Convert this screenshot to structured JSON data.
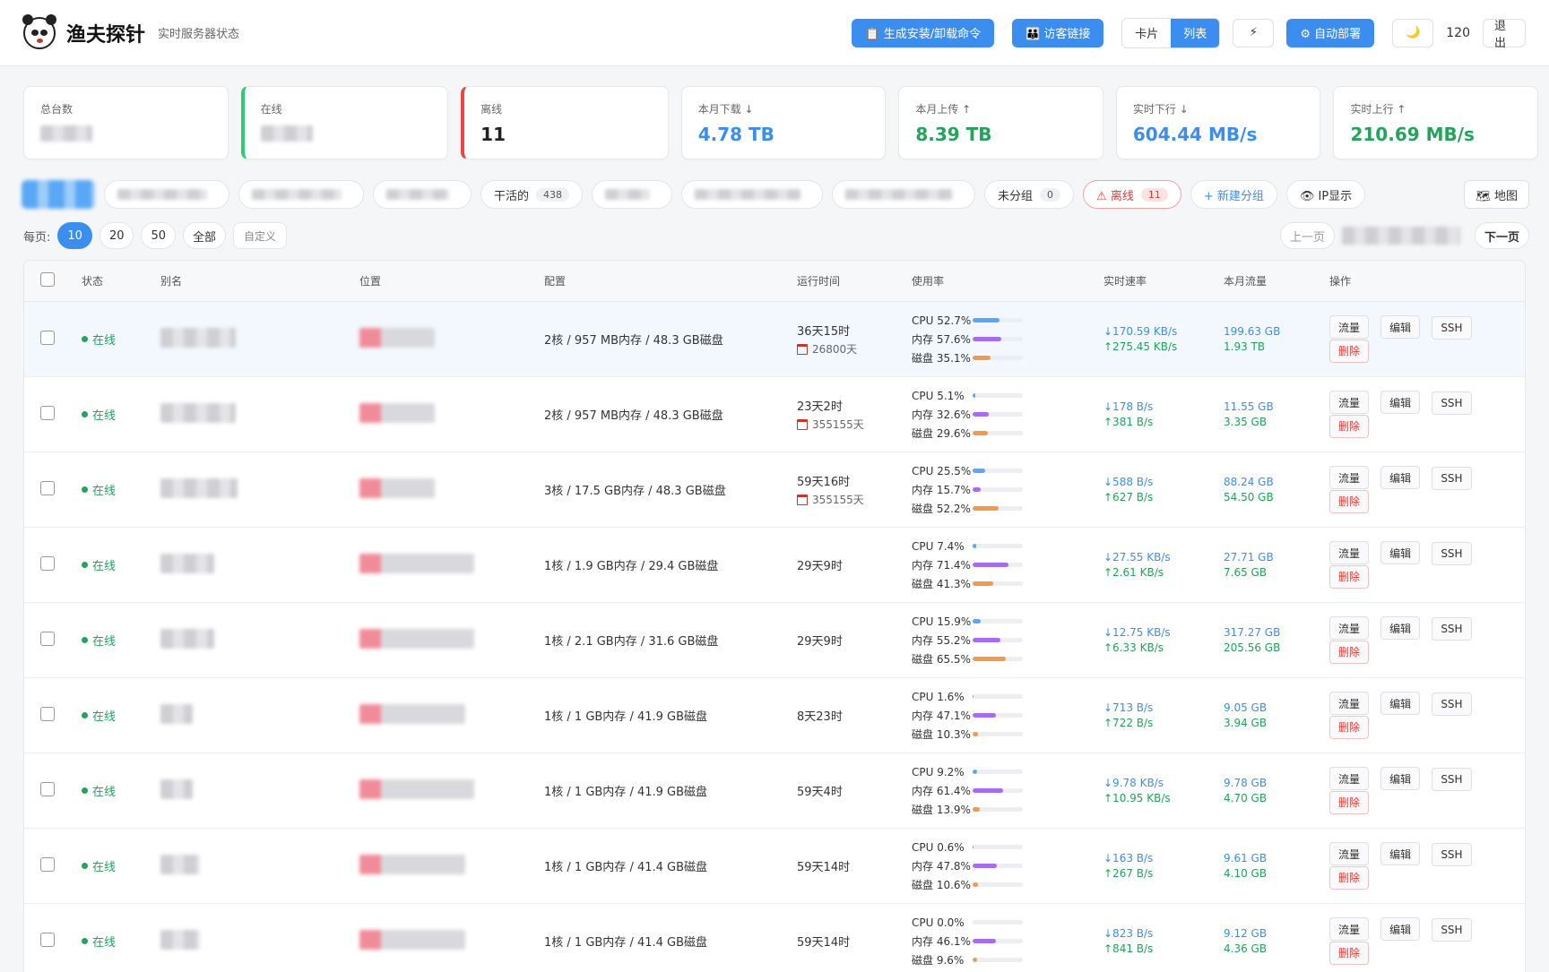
{
  "header": {
    "brand": "渔夫探针",
    "subtitle": "实时服务器状态",
    "gen_btn": "📋 生成安装/卸载命令",
    "visitor_btn": "👪 访客链接",
    "view_card": "卡片",
    "view_list": "列表",
    "flash_icon": "⚡",
    "deploy_btn": "⚙ 自动部署",
    "theme_icon": "🌙",
    "refresh": "120",
    "logout": "退出"
  },
  "stats": [
    {
      "label": "总台数",
      "value": ""
    },
    {
      "label": "在线",
      "value": ""
    },
    {
      "label": "离线",
      "value": "11"
    },
    {
      "label": "本月下载 ↓",
      "value": "4.78 TB"
    },
    {
      "label": "本月上传 ↑",
      "value": "8.39 TB"
    },
    {
      "label": "实时下行 ↓",
      "value": "604.44 MB/s"
    },
    {
      "label": "实时上行 ↑",
      "value": "210.69 MB/s"
    }
  ],
  "groups": {
    "ganhuo": {
      "label": "干活的",
      "count": "438"
    },
    "ungrouped": {
      "label": "未分组",
      "count": "0"
    },
    "offline": {
      "label": "⚠ 离线",
      "count": "11"
    },
    "new_group": "+ 新建分组",
    "ip_show": "👁 IP显示",
    "map": "🗺 地图"
  },
  "pager": {
    "label": "每页:",
    "options": [
      "10",
      "20",
      "50",
      "全部"
    ],
    "custom": "自定义",
    "prev": "上一页",
    "next": "下一页"
  },
  "table": {
    "headers": [
      "状态",
      "别名",
      "位置",
      "配置",
      "运行时间",
      "使用率",
      "实时速率",
      "本月流量",
      "操作"
    ],
    "actions": [
      "流量",
      "编辑",
      "SSH",
      "删除"
    ],
    "rows": [
      {
        "status": "在线",
        "config": "2核 / 957 MB内存 / 48.3 GB磁盘",
        "uptime": "36天15时",
        "expiry": "26800天",
        "cpu": "CPU 52.7%",
        "mem": "内存 57.6%",
        "disk": "磁盘 35.1%",
        "cpu_v": 52.7,
        "mem_v": 57.6,
        "disk_v": 35.1,
        "down": "↓170.59 KB/s",
        "up": "↑275.45 KB/s",
        "t1": "199.63 GB",
        "t2": "1.93 TB"
      },
      {
        "status": "在线",
        "config": "2核 / 957 MB内存 / 48.3 GB磁盘",
        "uptime": "23天2时",
        "expiry": "355155天",
        "cpu": "CPU 5.1%",
        "mem": "内存 32.6%",
        "disk": "磁盘 29.6%",
        "cpu_v": 5.1,
        "mem_v": 32.6,
        "disk_v": 29.6,
        "down": "↓178 B/s",
        "up": "↑381 B/s",
        "t1": "11.55 GB",
        "t2": "3.35 GB"
      },
      {
        "status": "在线",
        "config": "3核 / 17.5 GB内存 / 48.3 GB磁盘",
        "uptime": "59天16时",
        "expiry": "355155天",
        "cpu": "CPU 25.5%",
        "mem": "内存 15.7%",
        "disk": "磁盘 52.2%",
        "cpu_v": 25.5,
        "mem_v": 15.7,
        "disk_v": 52.2,
        "down": "↓588 B/s",
        "up": "↑627 B/s",
        "t1": "88.24 GB",
        "t2": "54.50 GB"
      },
      {
        "status": "在线",
        "config": "1核 / 1.9 GB内存 / 29.4 GB磁盘",
        "uptime": "29天9时",
        "expiry": "",
        "cpu": "CPU 7.4%",
        "mem": "内存 71.4%",
        "disk": "磁盘 41.3%",
        "cpu_v": 7.4,
        "mem_v": 71.4,
        "disk_v": 41.3,
        "down": "↓27.55 KB/s",
        "up": "↑2.61 KB/s",
        "t1": "27.71 GB",
        "t2": "7.65 GB"
      },
      {
        "status": "在线",
        "config": "1核 / 2.1 GB内存 / 31.6 GB磁盘",
        "uptime": "29天9时",
        "expiry": "",
        "cpu": "CPU 15.9%",
        "mem": "内存 55.2%",
        "disk": "磁盘 65.5%",
        "cpu_v": 15.9,
        "mem_v": 55.2,
        "disk_v": 65.5,
        "down": "↓12.75 KB/s",
        "up": "↑6.33 KB/s",
        "t1": "317.27 GB",
        "t2": "205.56 GB"
      },
      {
        "status": "在线",
        "config": "1核 / 1 GB内存 / 41.9 GB磁盘",
        "uptime": "8天23时",
        "expiry": "",
        "cpu": "CPU 1.6%",
        "mem": "内存 47.1%",
        "disk": "磁盘 10.3%",
        "cpu_v": 1.6,
        "mem_v": 47.1,
        "disk_v": 10.3,
        "down": "↓713 B/s",
        "up": "↑722 B/s",
        "t1": "9.05 GB",
        "t2": "3.94 GB"
      },
      {
        "status": "在线",
        "config": "1核 / 1 GB内存 / 41.9 GB磁盘",
        "uptime": "59天4时",
        "expiry": "",
        "cpu": "CPU 9.2%",
        "mem": "内存 61.4%",
        "disk": "磁盘 13.9%",
        "cpu_v": 9.2,
        "mem_v": 61.4,
        "disk_v": 13.9,
        "down": "↓9.78 KB/s",
        "up": "↑10.95 KB/s",
        "t1": "9.78 GB",
        "t2": "4.70 GB"
      },
      {
        "status": "在线",
        "config": "1核 / 1 GB内存 / 41.4 GB磁盘",
        "uptime": "59天14时",
        "expiry": "",
        "cpu": "CPU 0.6%",
        "mem": "内存 47.8%",
        "disk": "磁盘 10.6%",
        "cpu_v": 0.6,
        "mem_v": 47.8,
        "disk_v": 10.6,
        "down": "↓163 B/s",
        "up": "↑267 B/s",
        "t1": "9.61 GB",
        "t2": "4.10 GB"
      },
      {
        "status": "在线",
        "config": "1核 / 1 GB内存 / 41.4 GB磁盘",
        "uptime": "59天14时",
        "expiry": "",
        "cpu": "CPU 0.0%",
        "mem": "内存 46.1%",
        "disk": "磁盘 9.6%",
        "cpu_v": 0.0,
        "mem_v": 46.1,
        "disk_v": 9.6,
        "down": "↓823 B/s",
        "up": "↑841 B/s",
        "t1": "9.12 GB",
        "t2": "4.36 GB"
      }
    ]
  },
  "colors": {
    "accent": "#3b8ef0",
    "online": "#22a45a",
    "danger": "#e53935",
    "cpu_bar": "#5aa8f5",
    "mem_bar": "#a66bf0",
    "disk_bar": "#f39a4a"
  }
}
